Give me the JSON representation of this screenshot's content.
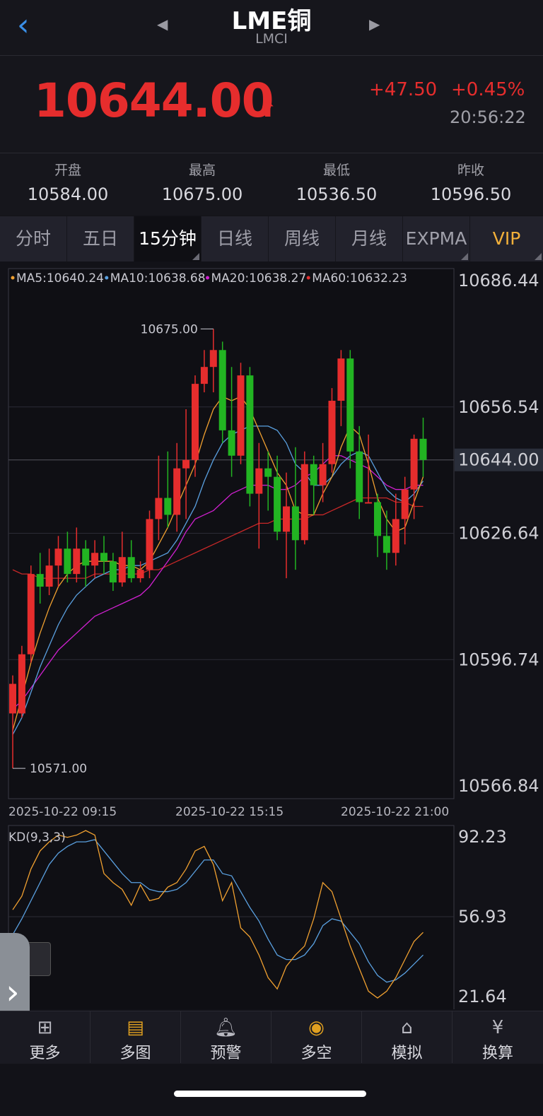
{
  "header": {
    "title": "LME铜",
    "subtitle": "LMCI"
  },
  "quote": {
    "price": "10644.00",
    "change": "+47.50",
    "change_pct": "+0.45%",
    "time": "20:56:22",
    "up_color": "#e62d2d"
  },
  "stats": [
    {
      "label": "开盘",
      "value": "10584.00"
    },
    {
      "label": "最高",
      "value": "10675.00"
    },
    {
      "label": "最低",
      "value": "10536.50"
    },
    {
      "label": "昨收",
      "value": "10596.50"
    }
  ],
  "tabs": [
    "分时",
    "五日",
    "15分钟",
    "日线",
    "周线",
    "月线",
    "EXPMA",
    "VIP"
  ],
  "active_tab": "15分钟",
  "legend": [
    {
      "text": "MA5:10640.24",
      "color": "#f0a030"
    },
    {
      "text": "MA10:10638.68",
      "color": "#5aa0e0"
    },
    {
      "text": "MA20:10638.27",
      "color": "#d020d0"
    },
    {
      "text": "MA60:10632.23",
      "color": "#e03030"
    }
  ],
  "y_axis_labels": [
    "10686.44",
    "10656.54",
    "10644.00",
    "10626.64",
    "10596.74",
    "10566.84"
  ],
  "high_label": "10675.00",
  "low_label": "10571.00",
  "date_labels": [
    "2025-10-22 09:15",
    "2025-10-22 15:15",
    "2025-10-22 21:00"
  ],
  "kd": {
    "label": "KD(9,3,3)",
    "y_axis_labels": [
      "92.23",
      "56.93",
      "21.64"
    ]
  },
  "chart_data": {
    "type": "candlestick",
    "ylim": [
      10566.84,
      10686.44
    ],
    "current_price": 10644.0,
    "candles": [
      [
        10584,
        10591,
        10571,
        10593
      ],
      [
        10584,
        10598,
        10583,
        10600
      ],
      [
        10598,
        10617,
        10596,
        10619
      ],
      [
        10617,
        10614,
        10610,
        10622
      ],
      [
        10614,
        10619,
        10612,
        10623
      ],
      [
        10619,
        10623,
        10614,
        10626
      ],
      [
        10623,
        10617,
        10615,
        10627
      ],
      [
        10617,
        10623,
        10615,
        10628
      ],
      [
        10623,
        10619,
        10614,
        10625
      ],
      [
        10619,
        10622,
        10616,
        10625
      ],
      [
        10622,
        10620,
        10617,
        10626
      ],
      [
        10620,
        10615,
        10613,
        10622
      ],
      [
        10615,
        10621,
        10614,
        10627
      ],
      [
        10621,
        10616,
        10615,
        10625
      ],
      [
        10616,
        10618,
        10615,
        10620
      ],
      [
        10618,
        10630,
        10616,
        10632
      ],
      [
        10630,
        10635,
        10625,
        10645
      ],
      [
        10635,
        10631,
        10628,
        10646
      ],
      [
        10631,
        10642,
        10627,
        10648
      ],
      [
        10642,
        10644,
        10630,
        10656
      ],
      [
        10644,
        10662,
        10640,
        10664
      ],
      [
        10662,
        10666,
        10660,
        10670
      ],
      [
        10666,
        10670,
        10660,
        10675
      ],
      [
        10670,
        10651,
        10648,
        10672
      ],
      [
        10651,
        10645,
        10640,
        10666
      ],
      [
        10645,
        10664,
        10643,
        10667
      ],
      [
        10664,
        10636,
        10633,
        10666
      ],
      [
        10636,
        10642,
        10623,
        10648
      ],
      [
        10642,
        10640,
        10632,
        10646
      ],
      [
        10640,
        10627,
        10625,
        10645
      ],
      [
        10627,
        10633,
        10616,
        10641
      ],
      [
        10633,
        10625,
        10618,
        10647
      ],
      [
        10625,
        10643,
        10624,
        10646
      ],
      [
        10643,
        10638,
        10631,
        10645
      ],
      [
        10638,
        10643,
        10634,
        10648
      ],
      [
        10643,
        10658,
        10641,
        10661
      ],
      [
        10658,
        10668,
        10652,
        10670
      ],
      [
        10668,
        10646,
        10642,
        10670
      ],
      [
        10646,
        10634,
        10630,
        10652
      ],
      [
        10634,
        10634,
        10634,
        10650
      ],
      [
        10634,
        10626,
        10621,
        10636
      ],
      [
        10626,
        10622,
        10618,
        10632
      ],
      [
        10622,
        10630,
        10619,
        10636
      ],
      [
        10630,
        10637,
        10624,
        10640
      ],
      [
        10637,
        10649,
        10630,
        10650
      ],
      [
        10649,
        10644,
        10640,
        10654
      ]
    ],
    "ma5": [
      10580,
      10588,
      10596,
      10603,
      10609,
      10614,
      10617,
      10619,
      10620,
      10620,
      10620,
      10620,
      10619,
      10619,
      10618,
      10620,
      10624,
      10628,
      10633,
      10638,
      10643,
      10650,
      10656,
      10659,
      10658,
      10659,
      10656,
      10651,
      10646,
      10641,
      10638,
      10632,
      10631,
      10631,
      10636,
      10640,
      10647,
      10652,
      10650,
      10643,
      10635,
      10630,
      10627,
      10628,
      10634,
      10640
    ],
    "ma10": [
      10579,
      10583,
      10589,
      10595,
      10600,
      10605,
      10609,
      10612,
      10614,
      10616,
      10617,
      10618,
      10618,
      10619,
      10619,
      10620,
      10621,
      10622,
      10625,
      10629,
      10633,
      10639,
      10644,
      10648,
      10650,
      10651,
      10652,
      10652,
      10652,
      10651,
      10648,
      10643,
      10641,
      10638,
      10638,
      10640,
      10643,
      10645,
      10646,
      10645,
      10641,
      10637,
      10635,
      10634,
      10636,
      10639
    ],
    "ma20": [
      10585,
      10587,
      10590,
      10593,
      10596,
      10599,
      10601,
      10603,
      10605,
      10607,
      10608,
      10609,
      10610,
      10611,
      10612,
      10614,
      10617,
      10620,
      10623,
      10627,
      10630,
      10631,
      10632,
      10634,
      10636,
      10637,
      10638,
      10638,
      10638,
      10637,
      10637,
      10638,
      10640,
      10641,
      10643,
      10645,
      10645,
      10644,
      10643,
      10642,
      10640,
      10638,
      10637,
      10637,
      10638,
      10638
    ],
    "ma60": [
      10618,
      10617,
      10617,
      10616,
      10616,
      10616,
      10616,
      10616,
      10616,
      10617,
      10617,
      10617,
      10617,
      10617,
      10617,
      10618,
      10618,
      10619,
      10620,
      10621,
      10622,
      10623,
      10624,
      10625,
      10626,
      10627,
      10628,
      10629,
      10629,
      10630,
      10630,
      10630,
      10630,
      10631,
      10631,
      10632,
      10633,
      10634,
      10635,
      10635,
      10635,
      10635,
      10634,
      10634,
      10633,
      10633
    ],
    "kd_ylim": [
      21.64,
      92.23
    ],
    "k": [
      60,
      66,
      78,
      86,
      90,
      93,
      92,
      93,
      95,
      93,
      76,
      72,
      69,
      62,
      71,
      64,
      65,
      70,
      72,
      78,
      86,
      88,
      80,
      64,
      72,
      52,
      48,
      40,
      30,
      25,
      35,
      40,
      44,
      56,
      72,
      68,
      56,
      44,
      34,
      24,
      21,
      24,
      30,
      38,
      46,
      50
    ],
    "d": [
      49,
      56,
      64,
      72,
      80,
      85,
      88,
      90,
      90,
      91,
      86,
      81,
      76,
      72,
      72,
      69,
      68,
      68,
      69,
      72,
      77,
      82,
      82,
      76,
      75,
      68,
      61,
      55,
      47,
      40,
      38,
      38,
      40,
      45,
      53,
      56,
      55,
      50,
      45,
      37,
      31,
      28,
      29,
      32,
      36,
      40
    ]
  },
  "nav": [
    {
      "label": "更多",
      "icon": "grid-icon"
    },
    {
      "label": "多图",
      "icon": "multi-chart-icon"
    },
    {
      "label": "预警",
      "icon": "bell-icon"
    },
    {
      "label": "多空",
      "icon": "trend-icon"
    },
    {
      "label": "模拟",
      "icon": "bank-icon"
    },
    {
      "label": "换算",
      "icon": "yen-icon"
    }
  ]
}
